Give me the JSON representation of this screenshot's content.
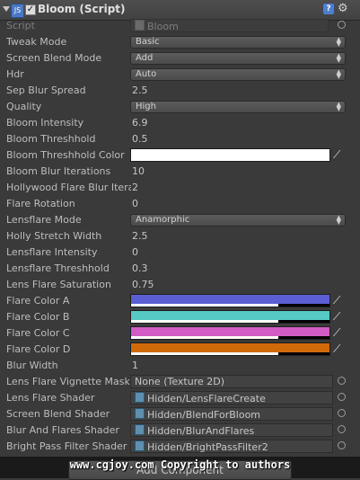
{
  "header": {
    "title": "Bloom (Script)",
    "js_icon": "JS",
    "help_icon": "?",
    "gear_icon": "⚙"
  },
  "rows": {
    "script": {
      "label": "Script",
      "value": "Bloom"
    },
    "tweak_mode": {
      "label": "Tweak Mode",
      "value": "Basic"
    },
    "screen_blend": {
      "label": "Screen Blend Mode",
      "value": "Add"
    },
    "hdr": {
      "label": "Hdr",
      "value": "Auto"
    },
    "sep_blur": {
      "label": "Sep Blur Spread",
      "value": "2.5"
    },
    "quality": {
      "label": "Quality",
      "value": "High"
    },
    "bloom_int": {
      "label": "Bloom Intensity",
      "value": "6.9"
    },
    "bloom_thr": {
      "label": "Bloom Threshhold",
      "value": "0.5"
    },
    "bloom_thr_col": {
      "label": "Bloom Threshhold Color",
      "color": "#ffffff"
    },
    "bloom_blur_it": {
      "label": "Bloom Blur Iterations",
      "value": "10"
    },
    "holly_blur_it": {
      "label": "Hollywood Flare Blur Iterations",
      "value": "2"
    },
    "flare_rot": {
      "label": "Flare Rotation",
      "value": "0"
    },
    "lens_mode": {
      "label": "Lensflare Mode",
      "value": "Anamorphic"
    },
    "holly_stretch": {
      "label": "Holly Stretch Width",
      "value": "2.5"
    },
    "lens_int": {
      "label": "Lensflare Intensity",
      "value": "0"
    },
    "lens_thr": {
      "label": "Lensflare Threshhold",
      "value": "0.3"
    },
    "lens_sat": {
      "label": "Lens Flare Saturation",
      "value": "0.75"
    },
    "flare_a": {
      "label": "Flare Color A",
      "color": "#5b5fd4"
    },
    "flare_b": {
      "label": "Flare Color B",
      "color": "#57c9c4"
    },
    "flare_c": {
      "label": "Flare Color C",
      "color": "#d05cc4"
    },
    "flare_d": {
      "label": "Flare Color D",
      "color": "#d06a08"
    },
    "blur_width": {
      "label": "Blur Width",
      "value": "1"
    },
    "vignette": {
      "label": "Lens Flare Vignette Mask",
      "value": "None (Texture 2D)"
    },
    "lens_shader": {
      "label": "Lens Flare Shader",
      "value": "Hidden/LensFlareCreate"
    },
    "blend_shader": {
      "label": "Screen Blend Shader",
      "value": "Hidden/BlendForBloom"
    },
    "blur_shader": {
      "label": "Blur And Flares Shader",
      "value": "Hidden/BlurAndFlares"
    },
    "bright_shader": {
      "label": "Bright Pass Filter Shader",
      "value": "Hidden/BrightPassFilter2"
    }
  },
  "footer": {
    "add_component": "Add Component",
    "watermark": "www.cgjoy.com Copyright to authors"
  }
}
